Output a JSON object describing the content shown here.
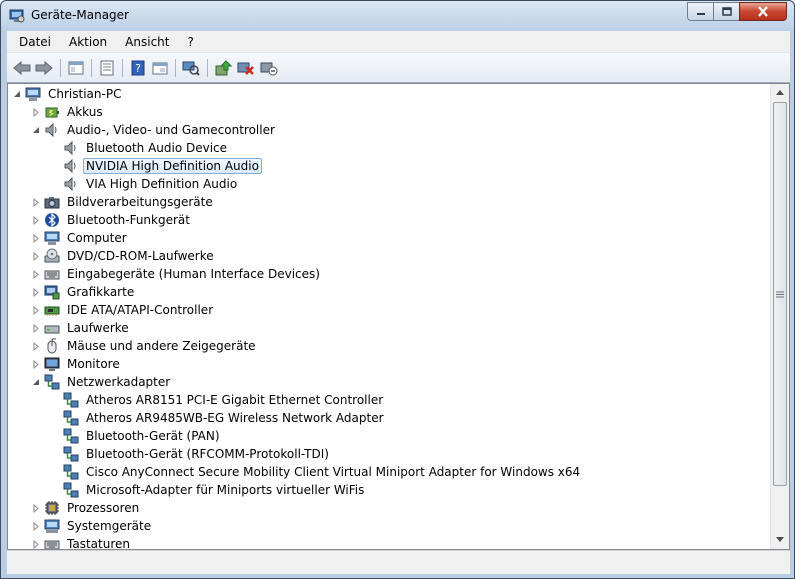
{
  "window": {
    "title": "Geräte-Manager"
  },
  "menu": [
    "Datei",
    "Aktion",
    "Ansicht",
    "?"
  ],
  "toolbar": [
    "back-icon",
    "forward-icon",
    "console-tree-icon",
    "properties-icon",
    "help-icon",
    "view-icon",
    "scan-hardware-icon",
    "update-driver-icon",
    "disable-device-icon",
    "uninstall-device-icon"
  ],
  "tree": {
    "root": "Christian-PC",
    "rows": [
      {
        "level": 1,
        "exp": "collapsed",
        "icon": "battery-icon",
        "label": "Akkus"
      },
      {
        "level": 1,
        "exp": "expanded",
        "icon": "speaker-icon",
        "label": "Audio-, Video- und Gamecontroller"
      },
      {
        "level": 2,
        "exp": "none",
        "icon": "speaker-icon",
        "label": "Bluetooth Audio Device"
      },
      {
        "level": 2,
        "exp": "none",
        "icon": "speaker-icon",
        "label": "NVIDIA High Definition Audio",
        "selected": true
      },
      {
        "level": 2,
        "exp": "none",
        "icon": "speaker-icon",
        "label": "VIA High Definition Audio"
      },
      {
        "level": 1,
        "exp": "collapsed",
        "icon": "camera-icon",
        "label": "Bildverarbeitungsgeräte"
      },
      {
        "level": 1,
        "exp": "collapsed",
        "icon": "bluetooth-icon",
        "label": "Bluetooth-Funkgerät"
      },
      {
        "level": 1,
        "exp": "collapsed",
        "icon": "computer-icon",
        "label": "Computer"
      },
      {
        "level": 1,
        "exp": "collapsed",
        "icon": "disc-drive-icon",
        "label": "DVD/CD-ROM-Laufwerke"
      },
      {
        "level": 1,
        "exp": "collapsed",
        "icon": "keyboard-icon",
        "label": "Eingabegeräte (Human Interface Devices)"
      },
      {
        "level": 1,
        "exp": "collapsed",
        "icon": "display-adapter-icon",
        "label": "Grafikkarte"
      },
      {
        "level": 1,
        "exp": "collapsed",
        "icon": "ide-controller-icon",
        "label": "IDE ATA/ATAPI-Controller"
      },
      {
        "level": 1,
        "exp": "collapsed",
        "icon": "drive-icon",
        "label": "Laufwerke"
      },
      {
        "level": 1,
        "exp": "collapsed",
        "icon": "mouse-icon",
        "label": "Mäuse und andere Zeigegeräte"
      },
      {
        "level": 1,
        "exp": "collapsed",
        "icon": "monitor-icon",
        "label": "Monitore"
      },
      {
        "level": 1,
        "exp": "expanded",
        "icon": "network-icon",
        "label": "Netzwerkadapter"
      },
      {
        "level": 2,
        "exp": "none",
        "icon": "network-icon",
        "label": "Atheros AR8151 PCI-E Gigabit Ethernet Controller"
      },
      {
        "level": 2,
        "exp": "none",
        "icon": "network-icon",
        "label": "Atheros AR9485WB-EG Wireless Network Adapter"
      },
      {
        "level": 2,
        "exp": "none",
        "icon": "network-icon",
        "label": "Bluetooth-Gerät (PAN)"
      },
      {
        "level": 2,
        "exp": "none",
        "icon": "network-icon",
        "label": "Bluetooth-Gerät (RFCOMM-Protokoll-TDI)"
      },
      {
        "level": 2,
        "exp": "none",
        "icon": "network-icon",
        "label": "Cisco AnyConnect Secure Mobility Client Virtual Miniport Adapter for Windows x64"
      },
      {
        "level": 2,
        "exp": "none",
        "icon": "network-icon",
        "label": "Microsoft-Adapter für Miniports virtueller WiFis"
      },
      {
        "level": 1,
        "exp": "collapsed",
        "icon": "processor-icon",
        "label": "Prozessoren"
      },
      {
        "level": 1,
        "exp": "collapsed",
        "icon": "system-devices-icon",
        "label": "Systemgeräte"
      },
      {
        "level": 1,
        "exp": "collapsed",
        "icon": "keyboard-icon",
        "label": "Tastaturen"
      }
    ]
  },
  "colors": {
    "selection_border": "#84acdd",
    "selection_fill": "#dcebfc",
    "window_frame": "#b9cde5",
    "close_button": "#c74631"
  }
}
